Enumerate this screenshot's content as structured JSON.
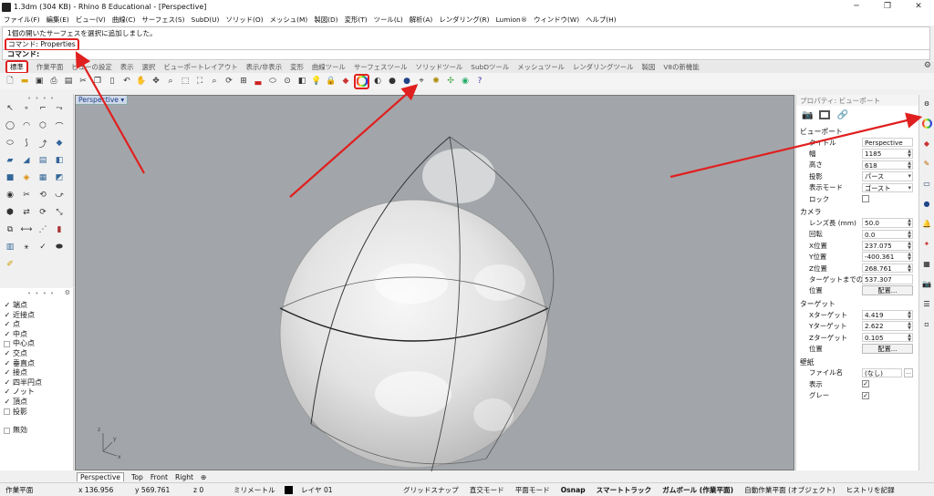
{
  "window": {
    "title": "1.3dm (304 KB) - Rhino 8 Educational - [Perspective]",
    "controls": [
      "─",
      "❐",
      "✕"
    ]
  },
  "menubar": [
    "ファイル(F)",
    "編集(E)",
    "ビュー(V)",
    "曲線(C)",
    "サーフェス(S)",
    "SubD(U)",
    "ソリッド(O)",
    "メッシュ(M)",
    "製図(D)",
    "変形(T)",
    "ツール(L)",
    "解析(A)",
    "レンダリング(R)",
    "Lumion®",
    "ウィンドウ(W)",
    "ヘルプ(H)"
  ],
  "command": {
    "history_line1": "1個の開いたサーフェスを選択に追加しました。",
    "history_line2": "コマンド: Properties",
    "prompt": "コマンド:"
  },
  "tabs": [
    "標準",
    "作業平面",
    "ビューの設定",
    "表示",
    "選択",
    "ビューポートレイアウト",
    "表示/非表示",
    "変形",
    "曲線ツール",
    "サーフェスツール",
    "ソリッドツール",
    "SubDツール",
    "メッシュツール",
    "レンダリングツール",
    "製図",
    "V8の新機能"
  ],
  "viewport": {
    "label": "Perspective",
    "tabs": [
      "Perspective",
      "Top",
      "Front",
      "Right"
    ]
  },
  "osnap": [
    {
      "label": "端点",
      "checked": true
    },
    {
      "label": "近接点",
      "checked": true
    },
    {
      "label": "点",
      "checked": true
    },
    {
      "label": "中点",
      "checked": true
    },
    {
      "label": "中心点",
      "checked": false
    },
    {
      "label": "交点",
      "checked": true
    },
    {
      "label": "垂直点",
      "checked": true
    },
    {
      "label": "接点",
      "checked": true
    },
    {
      "label": "四半円点",
      "checked": true
    },
    {
      "label": "ノット",
      "checked": true
    },
    {
      "label": "頂点",
      "checked": true
    },
    {
      "label": "投影",
      "checked": false
    },
    {
      "label": "無効",
      "checked": false
    }
  ],
  "properties": {
    "header": "プロパティ: ビューポート",
    "section_viewport": "ビューポート",
    "viewport_rows": [
      {
        "label": "タイトル",
        "value": "Perspective"
      },
      {
        "label": "幅",
        "value": "1185"
      },
      {
        "label": "高さ",
        "value": "618"
      },
      {
        "label": "投影",
        "value": "パース"
      },
      {
        "label": "表示モード",
        "value": "ゴースト"
      }
    ],
    "lock_label": "ロック",
    "section_camera": "カメラ",
    "camera_rows": [
      {
        "label": "レンズ長 (mm)",
        "value": "50.0"
      },
      {
        "label": "回転",
        "value": "0.0"
      },
      {
        "label": "X位置",
        "value": "237.075"
      },
      {
        "label": "Y位置",
        "value": "-400.361"
      },
      {
        "label": "Z位置",
        "value": "268.761"
      },
      {
        "label": "ターゲットまでの距離",
        "value": "537.307"
      }
    ],
    "camera_place_label": "位置",
    "place_button": "配置...",
    "section_target": "ターゲット",
    "target_rows": [
      {
        "label": "Xターゲット",
        "value": "4.419"
      },
      {
        "label": "Yターゲット",
        "value": "2.622"
      },
      {
        "label": "Zターゲット",
        "value": "0.105"
      }
    ],
    "target_place_label": "位置",
    "section_wallpaper": "壁紙",
    "file_label": "ファイル名",
    "file_value": "(なし)",
    "show_label": "表示",
    "gray_label": "グレー"
  },
  "statusbar": {
    "cplane": "作業平面",
    "x": "x 136.956",
    "y": "y 569.761",
    "z": "z 0",
    "units": "ミリメートル",
    "layer": "レイヤ 01",
    "grid_snap": "グリッドスナップ",
    "ortho": "直交モード",
    "planar": "平面モード",
    "osnap": "Osnap",
    "smarttrack": "スマートトラック",
    "gumball": "ガムボール (作業平面)",
    "auto_cplane": "自動作業平面 (オブジェクト)",
    "history": "ヒストリを記録"
  },
  "colors": {
    "accent_red": "#e02020",
    "viewport_bg": "#a2a6aa",
    "vp_label_bg": "#cfd9e8"
  }
}
